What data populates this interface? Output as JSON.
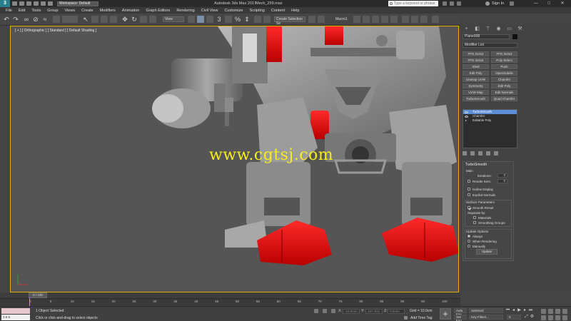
{
  "titlebar": {
    "logo": "3",
    "workspace": "Workspace: Default",
    "app_title": "Autodesk 3ds Max 2017",
    "file_name": "Mech_259.max",
    "search_placeholder": "Type a keyword or phrase",
    "sign_in": "Sign In",
    "minimize": "—",
    "maximize": "□",
    "close": "✕"
  },
  "menu": [
    "File",
    "Edit",
    "Tools",
    "Group",
    "Views",
    "Create",
    "Modifiers",
    "Animation",
    "Graph Editors",
    "Rendering",
    "Civil View",
    "Customize",
    "Scripting",
    "Content",
    "Help"
  ],
  "toolbar": {
    "view_select": "View",
    "snap_3": "3",
    "snap_angle": "%",
    "selection_set": "Create Selection Se",
    "macro": "Macro1"
  },
  "viewport": {
    "label": "[ + ] [ Orthographic ] [ Standard ] [ Default Shading ]",
    "watermark": "www.cgtsj.com"
  },
  "command_panel": {
    "object_name": "Plane008",
    "modifier_list": "Modifier List",
    "modifier_buttons": [
      "FFD 2x2x2",
      "FFD 3x3x3",
      "FFD 4x4x4",
      "Poly Select",
      "Shell",
      "Push",
      "Edit Poly",
      "OpenSubdiv",
      "Unwrap UVW",
      "Chamfer",
      "Symmetry",
      "Edit Poly",
      "UVW Map",
      "Edit Normals",
      "TurboSmooth",
      "Quad Chamfer"
    ],
    "stack": [
      {
        "label": "TurboSmooth",
        "selected": true
      },
      {
        "label": "Chamfer",
        "selected": false
      },
      {
        "label": "Editable Poly",
        "selected": false
      }
    ],
    "turbosmooth": {
      "title": "TurboSmooth",
      "main": "Main",
      "iterations_label": "Iterations:",
      "iterations": "3",
      "render_iters_label": "Render Iters:",
      "render_iters": "0",
      "isoline": "Isoline Display",
      "explicit_normals": "Explicit Normals",
      "surface_params": "Surface Parameters",
      "smooth_result": "Smooth Result",
      "separate_by": "Separate by:",
      "materials": "Materials",
      "smoothing_groups": "Smoothing Groups",
      "update_options": "Update Options",
      "always": "Always",
      "when_rendering": "When Rendering",
      "manually": "Manually",
      "update": "Update"
    }
  },
  "timeline": {
    "frame": "0 / 100",
    "ticks": [
      "0",
      "5",
      "10",
      "15",
      "20",
      "25",
      "30",
      "35",
      "40",
      "45",
      "50",
      "55",
      "60",
      "65",
      "70",
      "75",
      "80",
      "85",
      "90",
      "95",
      "100"
    ]
  },
  "status": {
    "script_line": "3 5 5",
    "selected": "1 Object Selected",
    "prompt": "Click or click-and-drag to select objects",
    "x_label": "X:",
    "x_value": "-16.0mm",
    "y_label": "Y:",
    "y_value": "167.7ktc",
    "z_label": "Z:",
    "z_value": "0.0mm",
    "grid": "Grid = 10.0cm",
    "add_time_tag": "Add Time Tag",
    "auto_key": "Auto Key",
    "selected_dropdown": "Selected",
    "set_key": "Set Key",
    "key_filters": "Key Filters...",
    "add_key": "+",
    "frame_field": "0"
  },
  "colors": {
    "accent": "#e0b000",
    "selection_red": "#ee1111",
    "stack_selected": "#5c8fd6",
    "watermark": "#f5ee1a"
  }
}
